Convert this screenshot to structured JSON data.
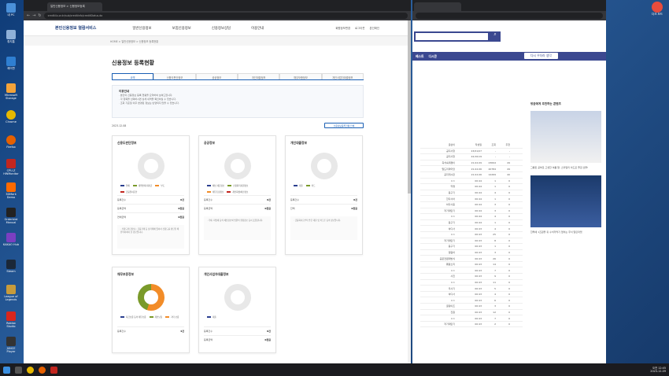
{
  "desktop": {
    "icons": [
      "내 PC",
      "휴지통",
      "제어판",
      "Microsoft Storage",
      "Chrome",
      "Firefox",
      "CPU-Z HWMonitor",
      "3DMark Demo",
      "Orderbird Manual",
      "Realtek Audio",
      "KAKAO Hub",
      "Steam",
      "League of Legends",
      "Roblox Studio",
      "JUNCE Player"
    ],
    "right_icon": "다크 모드"
  },
  "browser_left": {
    "tab1": "일반신용정보 > 신용정보등록",
    "tab2": "",
    "url": "credit4u.or.kr/sub/creditinfo/creditStatus.do",
    "site": {
      "logo": "본인신용정보 열람서비스",
      "menu": [
        "일반신용정보",
        "보험신용정보",
        "신용정보상담",
        "이용안내"
      ],
      "util": [
        "회원정보변경",
        "로그아웃",
        "본인확인"
      ]
    },
    "breadcrumb": "HOME > 일반신용정보 > 신용정보 등록현황",
    "title": "신용정보 등록현황",
    "tabs": [
      "요약",
      "신용도판단정보",
      "공공정보",
      "개인대출정보",
      "채무보증정보",
      "개인사업자대출정보"
    ],
    "notice": {
      "head": "이용안내",
      "lines": [
        "· 본인의 신용정보 등록 현황을 요약하여 보여드립니다.",
        "· 각 항목을 선택하시면 상세 내역을 확인하실 수 있습니다.",
        "· 조회 기준일 이후 변경된 정보는 반영되지 않을 수 있습니다."
      ]
    },
    "date": "2023.12.08",
    "print_btn": "신용정보등록현황 인쇄",
    "cards": [
      {
        "title": "신용도판단정보",
        "legend": [
          "연체",
          "대위변제·대지급",
          "부도",
          "관련인",
          "금융질서문란"
        ],
        "rows": [
          [
            "등록건수",
            "0건"
          ],
          [
            "등록금액",
            "0천원"
          ],
          [
            "연체금액",
            "0천원"
          ]
        ],
        "note": "· 신용도판단정보는 금융거래 등 상거래에 있어서 신용도를 판단할 때 유의하여야 할 정보입니다."
      },
      {
        "title": "공공정보",
        "legend": [
          "체납 세금정보",
          "신용회복지원정보",
          "채무조정정보",
          "개인회생/파산정보"
        ],
        "rows": [
          [
            "등록건수",
            "0건"
          ],
          [
            "등록금액",
            "0천원"
          ]
        ],
        "note": "· 국세, 지방세 등의 체납정보와 법원의 결정정보 등이 포함됩니다."
      },
      {
        "title": "개인대출정보",
        "legend": [
          "대출",
          "카드",
          "할부"
        ],
        "rows": [
          [
            "등록건수",
            "0건"
          ],
          [
            "잔액",
            "0천원"
          ]
        ],
        "note": "· 금융회사로부터 받은 대출 및 카드론 등의 정보입니다."
      },
      {
        "title": "채무보증정보",
        "legend": [
          "지급보증 등의 채무보증",
          "개인보증",
          "기타 보증"
        ],
        "rows": [
          [
            "등록건수",
            "4건"
          ]
        ],
        "note": ""
      },
      {
        "title": "개인사업자대출정보",
        "legend": [
          "대출"
        ],
        "rows": [
          [
            "등록건수",
            "0건"
          ],
          [
            "등록금액",
            "0천원"
          ]
        ],
        "note": ""
      }
    ]
  },
  "browser_right": {
    "bar": [
      "베스트",
      "디시콘"
    ],
    "banner": "다시 우더라 생각",
    "list": [
      [
        "글쓴이",
        "작성일",
        "조회",
        "추천"
      ],
      [
        "공지사항",
        "23/01/07",
        "-",
        "-"
      ],
      [
        "공지사항",
        "22/10/19",
        "-",
        "-"
      ],
      [
        "즉석숙제쟁이",
        "21.02.09",
        "23694",
        "49"
      ],
      [
        "말도리마마당",
        "21.02.06",
        "20784",
        "49"
      ],
      [
        "공지게시판",
        "21.02.06",
        "12269",
        "40"
      ],
      [
        "ㅇㅇ",
        "00:44",
        "1",
        "0"
      ],
      [
        "익명",
        "00:44",
        "1",
        "0"
      ],
      [
        "동구기",
        "00:44",
        "4",
        "0"
      ],
      [
        "한다사아",
        "00:44",
        "1",
        "0"
      ],
      [
        "하다사중",
        "00:44",
        "3",
        "0"
      ],
      [
        "작가대만기",
        "00:44",
        "3",
        "0"
      ],
      [
        "ㅇㅇ",
        "00:44",
        "4",
        "0"
      ],
      [
        "동구기",
        "00:44",
        "1",
        "0"
      ],
      [
        "하다사",
        "00:43",
        "4",
        "0"
      ],
      [
        "ㅇㅇ",
        "00:43",
        "25",
        "0"
      ],
      [
        "작가대만기",
        "00:43",
        "8",
        "0"
      ],
      [
        "동구기",
        "00:43",
        "1",
        "0"
      ],
      [
        "컬럼어",
        "00:43",
        "3",
        "0"
      ],
      [
        "공문전렴제방식",
        "00:43",
        "26",
        "0"
      ],
      [
        "웨팡소리",
        "00:43",
        "14",
        "0"
      ],
      [
        "ㅇㅇ",
        "00:43",
        "7",
        "0"
      ],
      [
        "사진",
        "00:43",
        "9",
        "0"
      ],
      [
        "ㅇㅇ",
        "00:43",
        "11",
        "0"
      ],
      [
        "우사기",
        "00:43",
        "5",
        "0"
      ],
      [
        "하다사",
        "00:43",
        "4",
        "0"
      ],
      [
        "ㅇㅇ",
        "00:43",
        "6",
        "0"
      ],
      [
        "굴렁이조",
        "00:43",
        "3",
        "0"
      ],
      [
        "진원",
        "00:43",
        "12",
        "0"
      ],
      [
        "ㅇㅇ",
        "00:43",
        "7",
        "0"
      ],
      [
        "작가대만기",
        "00:43",
        "2",
        "0"
      ]
    ],
    "side": {
      "ad_title": "방금에게 추천하는 콘텐츠",
      "cap1": "그룹핀 공부로 고생한 여름 말, 스마일리 아드로 즐겁 선물!",
      "cap2": "한투에 1조원을 휘 수석저먹기 없어는 주식 알린마켓"
    }
  },
  "taskbar": {
    "time": "오전 12:45",
    "date": "2023-12-09"
  }
}
